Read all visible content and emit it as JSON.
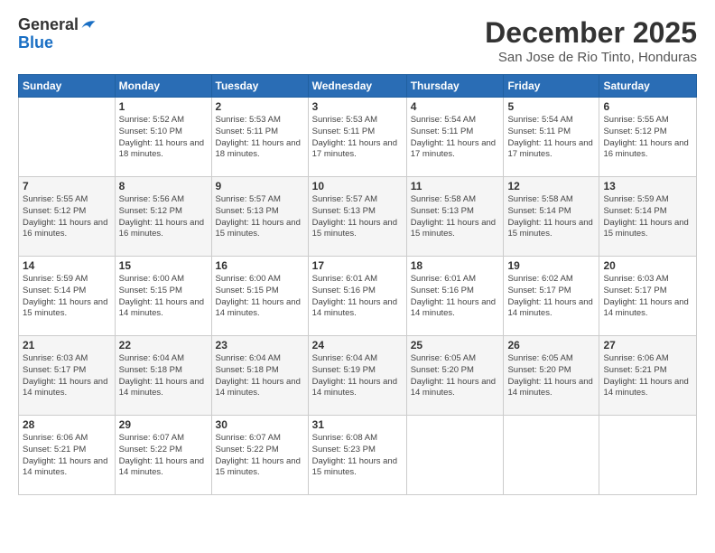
{
  "app": {
    "logo_line1": "General",
    "logo_line2": "Blue"
  },
  "header": {
    "month": "December 2025",
    "location": "San Jose de Rio Tinto, Honduras"
  },
  "weekdays": [
    "Sunday",
    "Monday",
    "Tuesday",
    "Wednesday",
    "Thursday",
    "Friday",
    "Saturday"
  ],
  "weeks": [
    [
      {
        "day": "",
        "info": ""
      },
      {
        "day": "1",
        "info": "Sunrise: 5:52 AM\nSunset: 5:10 PM\nDaylight: 11 hours\nand 18 minutes."
      },
      {
        "day": "2",
        "info": "Sunrise: 5:53 AM\nSunset: 5:11 PM\nDaylight: 11 hours\nand 18 minutes."
      },
      {
        "day": "3",
        "info": "Sunrise: 5:53 AM\nSunset: 5:11 PM\nDaylight: 11 hours\nand 17 minutes."
      },
      {
        "day": "4",
        "info": "Sunrise: 5:54 AM\nSunset: 5:11 PM\nDaylight: 11 hours\nand 17 minutes."
      },
      {
        "day": "5",
        "info": "Sunrise: 5:54 AM\nSunset: 5:11 PM\nDaylight: 11 hours\nand 17 minutes."
      },
      {
        "day": "6",
        "info": "Sunrise: 5:55 AM\nSunset: 5:12 PM\nDaylight: 11 hours\nand 16 minutes."
      }
    ],
    [
      {
        "day": "7",
        "info": "Sunrise: 5:55 AM\nSunset: 5:12 PM\nDaylight: 11 hours\nand 16 minutes."
      },
      {
        "day": "8",
        "info": "Sunrise: 5:56 AM\nSunset: 5:12 PM\nDaylight: 11 hours\nand 16 minutes."
      },
      {
        "day": "9",
        "info": "Sunrise: 5:57 AM\nSunset: 5:13 PM\nDaylight: 11 hours\nand 15 minutes."
      },
      {
        "day": "10",
        "info": "Sunrise: 5:57 AM\nSunset: 5:13 PM\nDaylight: 11 hours\nand 15 minutes."
      },
      {
        "day": "11",
        "info": "Sunrise: 5:58 AM\nSunset: 5:13 PM\nDaylight: 11 hours\nand 15 minutes."
      },
      {
        "day": "12",
        "info": "Sunrise: 5:58 AM\nSunset: 5:14 PM\nDaylight: 11 hours\nand 15 minutes."
      },
      {
        "day": "13",
        "info": "Sunrise: 5:59 AM\nSunset: 5:14 PM\nDaylight: 11 hours\nand 15 minutes."
      }
    ],
    [
      {
        "day": "14",
        "info": "Sunrise: 5:59 AM\nSunset: 5:14 PM\nDaylight: 11 hours\nand 15 minutes."
      },
      {
        "day": "15",
        "info": "Sunrise: 6:00 AM\nSunset: 5:15 PM\nDaylight: 11 hours\nand 14 minutes."
      },
      {
        "day": "16",
        "info": "Sunrise: 6:00 AM\nSunset: 5:15 PM\nDaylight: 11 hours\nand 14 minutes."
      },
      {
        "day": "17",
        "info": "Sunrise: 6:01 AM\nSunset: 5:16 PM\nDaylight: 11 hours\nand 14 minutes."
      },
      {
        "day": "18",
        "info": "Sunrise: 6:01 AM\nSunset: 5:16 PM\nDaylight: 11 hours\nand 14 minutes."
      },
      {
        "day": "19",
        "info": "Sunrise: 6:02 AM\nSunset: 5:17 PM\nDaylight: 11 hours\nand 14 minutes."
      },
      {
        "day": "20",
        "info": "Sunrise: 6:03 AM\nSunset: 5:17 PM\nDaylight: 11 hours\nand 14 minutes."
      }
    ],
    [
      {
        "day": "21",
        "info": "Sunrise: 6:03 AM\nSunset: 5:17 PM\nDaylight: 11 hours\nand 14 minutes."
      },
      {
        "day": "22",
        "info": "Sunrise: 6:04 AM\nSunset: 5:18 PM\nDaylight: 11 hours\nand 14 minutes."
      },
      {
        "day": "23",
        "info": "Sunrise: 6:04 AM\nSunset: 5:18 PM\nDaylight: 11 hours\nand 14 minutes."
      },
      {
        "day": "24",
        "info": "Sunrise: 6:04 AM\nSunset: 5:19 PM\nDaylight: 11 hours\nand 14 minutes."
      },
      {
        "day": "25",
        "info": "Sunrise: 6:05 AM\nSunset: 5:20 PM\nDaylight: 11 hours\nand 14 minutes."
      },
      {
        "day": "26",
        "info": "Sunrise: 6:05 AM\nSunset: 5:20 PM\nDaylight: 11 hours\nand 14 minutes."
      },
      {
        "day": "27",
        "info": "Sunrise: 6:06 AM\nSunset: 5:21 PM\nDaylight: 11 hours\nand 14 minutes."
      }
    ],
    [
      {
        "day": "28",
        "info": "Sunrise: 6:06 AM\nSunset: 5:21 PM\nDaylight: 11 hours\nand 14 minutes."
      },
      {
        "day": "29",
        "info": "Sunrise: 6:07 AM\nSunset: 5:22 PM\nDaylight: 11 hours\nand 14 minutes."
      },
      {
        "day": "30",
        "info": "Sunrise: 6:07 AM\nSunset: 5:22 PM\nDaylight: 11 hours\nand 15 minutes."
      },
      {
        "day": "31",
        "info": "Sunrise: 6:08 AM\nSunset: 5:23 PM\nDaylight: 11 hours\nand 15 minutes."
      },
      {
        "day": "",
        "info": ""
      },
      {
        "day": "",
        "info": ""
      },
      {
        "day": "",
        "info": ""
      }
    ]
  ]
}
